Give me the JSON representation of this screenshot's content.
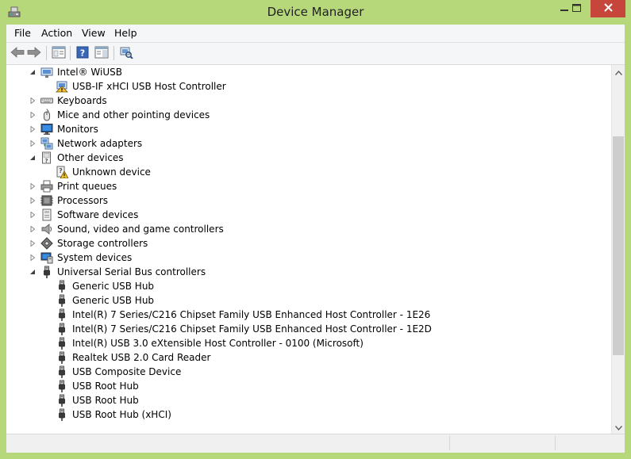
{
  "window": {
    "title": "Device Manager",
    "icon": "device-manager-icon",
    "controls": [
      "minimize-icon",
      "maximize-icon",
      "close-icon"
    ],
    "colors": {
      "frame": "#b6d77a",
      "close": "#c7463b",
      "text": "#222222"
    }
  },
  "menu": [
    "File",
    "Action",
    "View",
    "Help"
  ],
  "toolbar": [
    "back-arrow-icon",
    "forward-arrow-icon",
    "properties-icon",
    "help-icon",
    "details-pane-icon",
    "scan-hardware-icon"
  ],
  "tree": [
    {
      "level": 1,
      "expanded": true,
      "icon": "wireless-usb-icon",
      "label": "Intel® WiUSB"
    },
    {
      "level": 2,
      "icon": "warning-device-icon",
      "label": "USB-IF xHCI USB Host Controller"
    },
    {
      "level": 1,
      "expanded": false,
      "icon": "keyboard-icon",
      "label": "Keyboards"
    },
    {
      "level": 1,
      "expanded": false,
      "icon": "mouse-icon",
      "label": "Mice and other pointing devices"
    },
    {
      "level": 1,
      "expanded": false,
      "icon": "monitor-icon",
      "label": "Monitors"
    },
    {
      "level": 1,
      "expanded": false,
      "icon": "network-icon",
      "label": "Network adapters"
    },
    {
      "level": 1,
      "expanded": true,
      "icon": "unknown-device-icon",
      "label": "Other devices"
    },
    {
      "level": 2,
      "icon": "unknown-warning-icon",
      "label": "Unknown device"
    },
    {
      "level": 1,
      "expanded": false,
      "icon": "printer-icon",
      "label": "Print queues"
    },
    {
      "level": 1,
      "expanded": false,
      "icon": "processor-icon",
      "label": "Processors"
    },
    {
      "level": 1,
      "expanded": false,
      "icon": "software-device-icon",
      "label": "Software devices"
    },
    {
      "level": 1,
      "expanded": false,
      "icon": "speaker-icon",
      "label": "Sound, video and game controllers"
    },
    {
      "level": 1,
      "expanded": false,
      "icon": "storage-icon",
      "label": "Storage controllers"
    },
    {
      "level": 1,
      "expanded": false,
      "icon": "system-device-icon",
      "label": "System devices"
    },
    {
      "level": 1,
      "expanded": true,
      "icon": "usb-plug-icon",
      "label": "Universal Serial Bus controllers"
    },
    {
      "level": 2,
      "icon": "usb-plug-icon",
      "label": "Generic USB Hub"
    },
    {
      "level": 2,
      "icon": "usb-plug-icon",
      "label": "Generic USB Hub"
    },
    {
      "level": 2,
      "icon": "usb-plug-icon",
      "label": "Intel(R) 7 Series/C216 Chipset Family USB Enhanced Host Controller - 1E26"
    },
    {
      "level": 2,
      "icon": "usb-plug-icon",
      "label": "Intel(R) 7 Series/C216 Chipset Family USB Enhanced Host Controller - 1E2D"
    },
    {
      "level": 2,
      "icon": "usb-plug-icon",
      "label": "Intel(R) USB 3.0 eXtensible Host Controller - 0100 (Microsoft)"
    },
    {
      "level": 2,
      "icon": "usb-plug-icon",
      "label": "Realtek USB 2.0 Card Reader"
    },
    {
      "level": 2,
      "icon": "usb-plug-icon",
      "label": "USB Composite Device"
    },
    {
      "level": 2,
      "icon": "usb-plug-icon",
      "label": "USB Root Hub"
    },
    {
      "level": 2,
      "icon": "usb-plug-icon",
      "label": "USB Root Hub"
    },
    {
      "level": 2,
      "icon": "usb-plug-icon",
      "label": "USB Root Hub (xHCI)"
    }
  ],
  "scrollbar": {
    "position": 0.47,
    "visible_fraction": 0.64
  }
}
